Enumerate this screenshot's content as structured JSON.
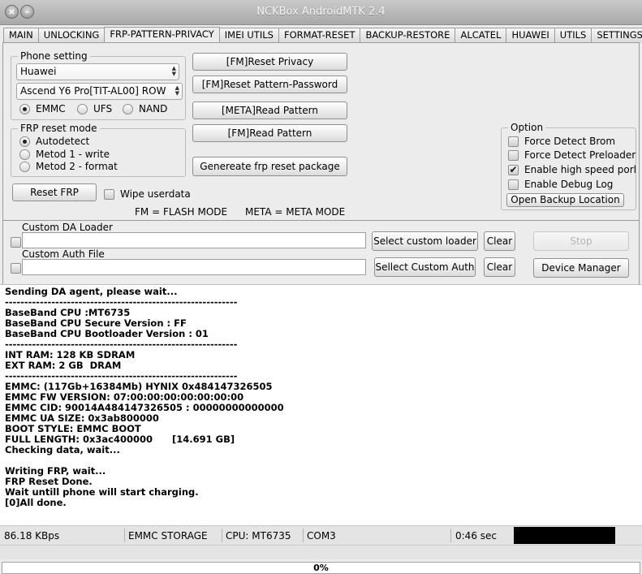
{
  "window": {
    "title": "NCKBox AndroidMTK 2.4"
  },
  "tabs": [
    {
      "label": "MAIN"
    },
    {
      "label": "UNLOCKING"
    },
    {
      "label": "FRP-PATTERN-PRIVACY"
    },
    {
      "label": "IMEI UTILS"
    },
    {
      "label": "FORMAT-RESET"
    },
    {
      "label": "BACKUP-RESTORE"
    },
    {
      "label": "ALCATEL"
    },
    {
      "label": "HUAWEI"
    },
    {
      "label": "UTILS"
    },
    {
      "label": "SETTINGS"
    }
  ],
  "active_tab": "FRP-PATTERN-PRIVACY",
  "phone_setting": {
    "legend": "Phone setting",
    "brand": "Huawei",
    "model": "Ascend Y6 Pro[TIT-AL00] ROW",
    "storage_options": [
      {
        "label": "EMMC",
        "selected": true
      },
      {
        "label": "UFS",
        "selected": false
      },
      {
        "label": "NAND",
        "selected": false
      }
    ]
  },
  "frp_reset_mode": {
    "legend": "FRP reset mode",
    "options": [
      {
        "label": "Autodetect",
        "selected": true
      },
      {
        "label": "Metod 1 - write",
        "selected": false
      },
      {
        "label": "Metod 2 - format",
        "selected": false
      }
    ]
  },
  "reset_frp_button": "Reset FRP",
  "wipe_userdata": {
    "label": "Wipe userdata",
    "checked": false
  },
  "actions": {
    "reset_privacy": "[FM]Reset Privacy",
    "reset_pattern_password": "[FM]Reset Pattern-Password",
    "meta_read_pattern": "[META]Read Pattern",
    "fm_read_pattern": "[FM]Read Pattern",
    "generate_package": "Genereate frp reset package"
  },
  "legend_notes": {
    "fm": "FM = FLASH MODE",
    "meta": "META = META MODE"
  },
  "option_group": {
    "legend": "Option",
    "items": [
      {
        "label": "Force Detect Brom",
        "checked": false
      },
      {
        "label": "Force Detect Preloader",
        "checked": false
      },
      {
        "label": "Enable high speed porl",
        "checked": true
      },
      {
        "label": "Enable Debug Log",
        "checked": false
      }
    ],
    "open_backup_location": "Open Backup Location"
  },
  "custom_da": {
    "label": "Custom DA Loader",
    "value": "",
    "select_button": "Select custom loader",
    "clear_button": "Clear"
  },
  "custom_auth": {
    "label": "Custom Auth File",
    "value": "",
    "select_button": "Sellect Custom Auth",
    "clear_button": "Clear"
  },
  "stop_button": "Stop",
  "device_manager_button": "Device Manager",
  "log_lines": [
    "Sending DA agent, please wait...",
    "------------------------------------------------------------",
    "BaseBand CPU :MT6735",
    "BaseBand CPU Secure Version : FF",
    "BaseBand CPU Bootloader Version : 01",
    "------------------------------------------------------------",
    "INT RAM: 128 KB SDRAM",
    "EXT RAM: 2 GB  DRAM",
    "------------------------------------------------------------",
    "EMMC: (117Gb+16384Mb) HYNIX 0x484147326505",
    "EMMC FW VERSION: 07:00:00:00:00:00:00:00",
    "EMMC CID: 90014A484147326505 : 00000000000000",
    "EMMC UA SIZE: 0x3ab800000",
    "BOOT STYLE: EMMC BOOT",
    "FULL LENGTH: 0x3ac400000      [14.691 GB]",
    "Checking data, wait...",
    "",
    "Writing FRP, wait...",
    "FRP Reset Done.",
    "Wait untill phone will start charging.",
    "[0]All done."
  ],
  "status": {
    "speed": "86.18 KBps",
    "storage": "EMMC STORAGE",
    "cpu": "CPU: MT6735",
    "port": "COM3",
    "time": "0:46 sec"
  },
  "progress": {
    "value": 0,
    "label": "0%"
  }
}
